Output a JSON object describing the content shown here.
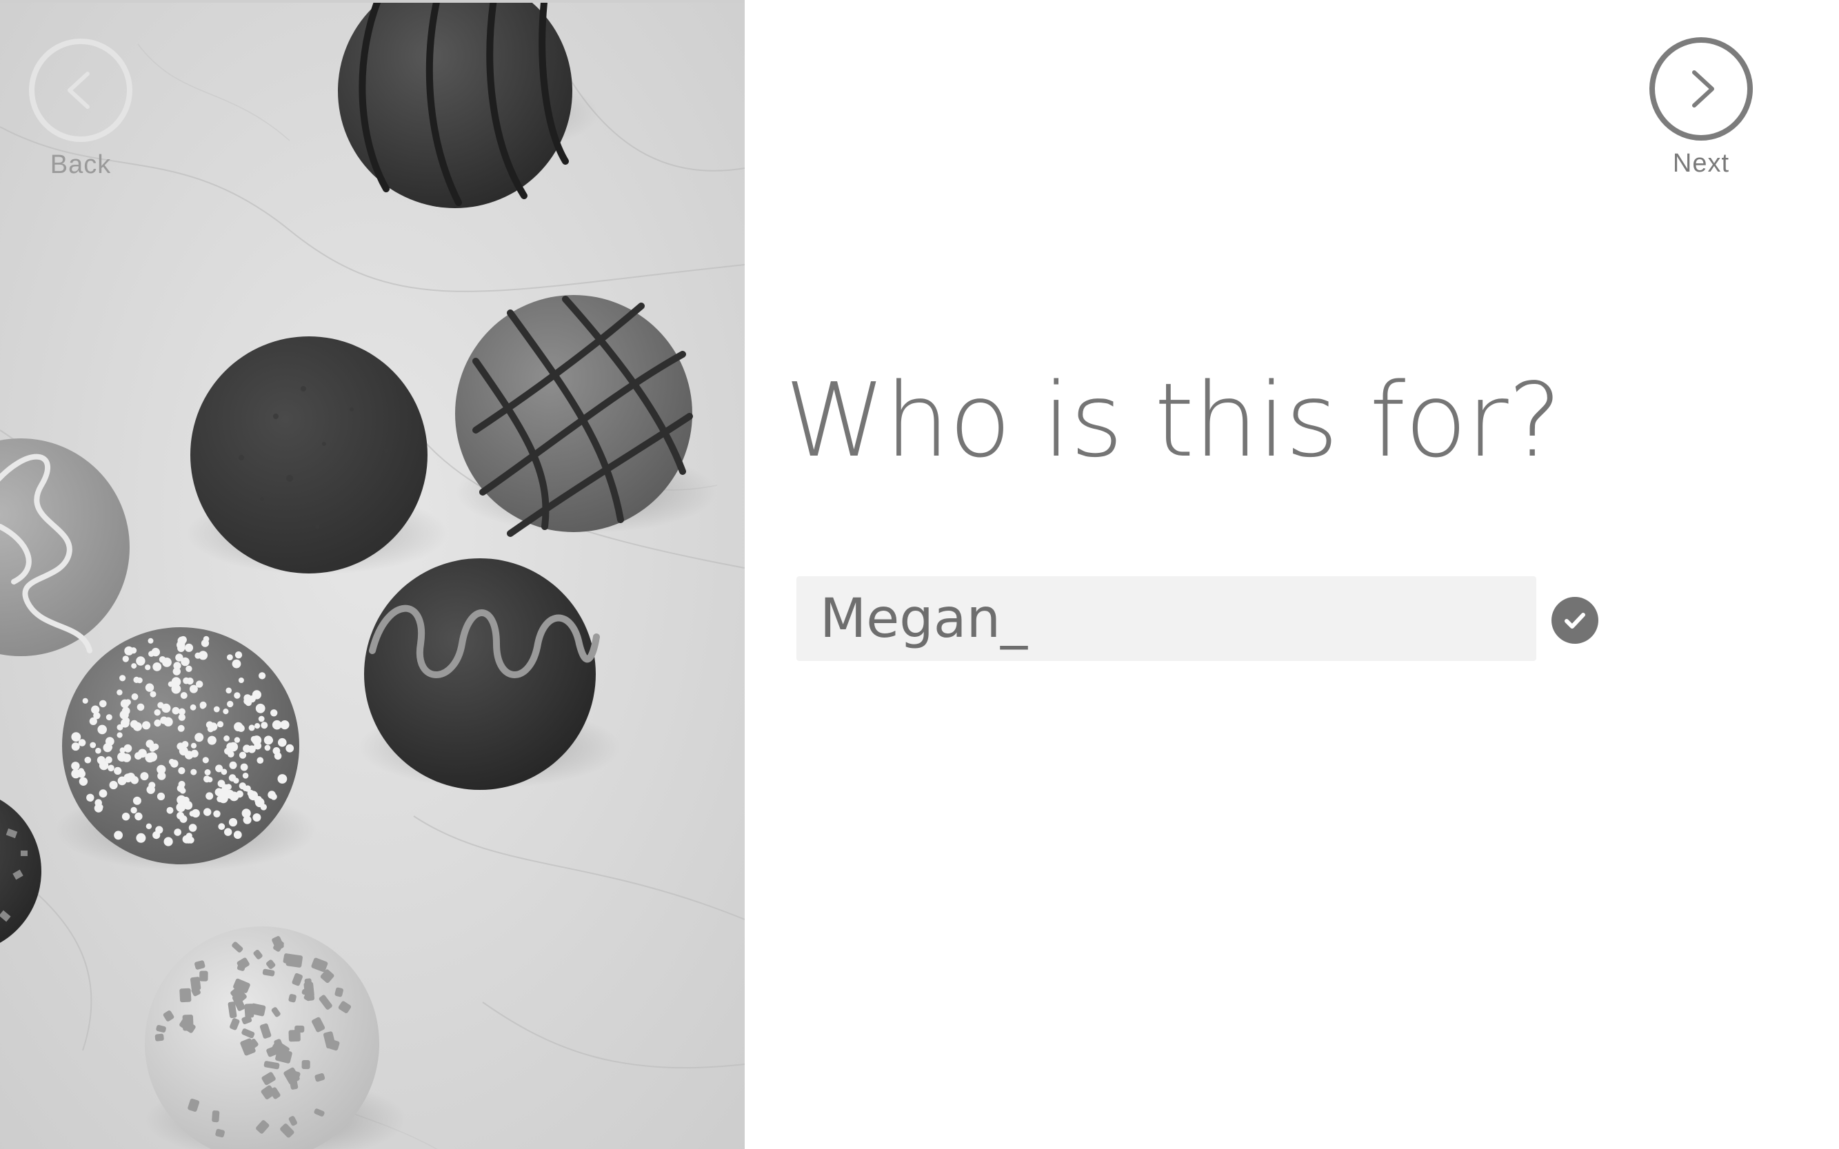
{
  "navigation": {
    "back": {
      "label": "Back",
      "icon": "chevron-left-icon"
    },
    "next": {
      "label": "Next",
      "icon": "chevron-right-icon"
    }
  },
  "question": {
    "title": "Who is this for?"
  },
  "recipient_input": {
    "value": "Megan_",
    "confirm_icon": "checkmark-icon"
  },
  "photo": {
    "subject": "chocolate-truffles-on-marble",
    "style": "grayscale"
  },
  "colors": {
    "text_gray": "#757575",
    "input_background": "#f2f2f2",
    "next_circle": "#7c7c7c",
    "back_circle": "#e4e4e4",
    "confirm_background": "#737373"
  }
}
